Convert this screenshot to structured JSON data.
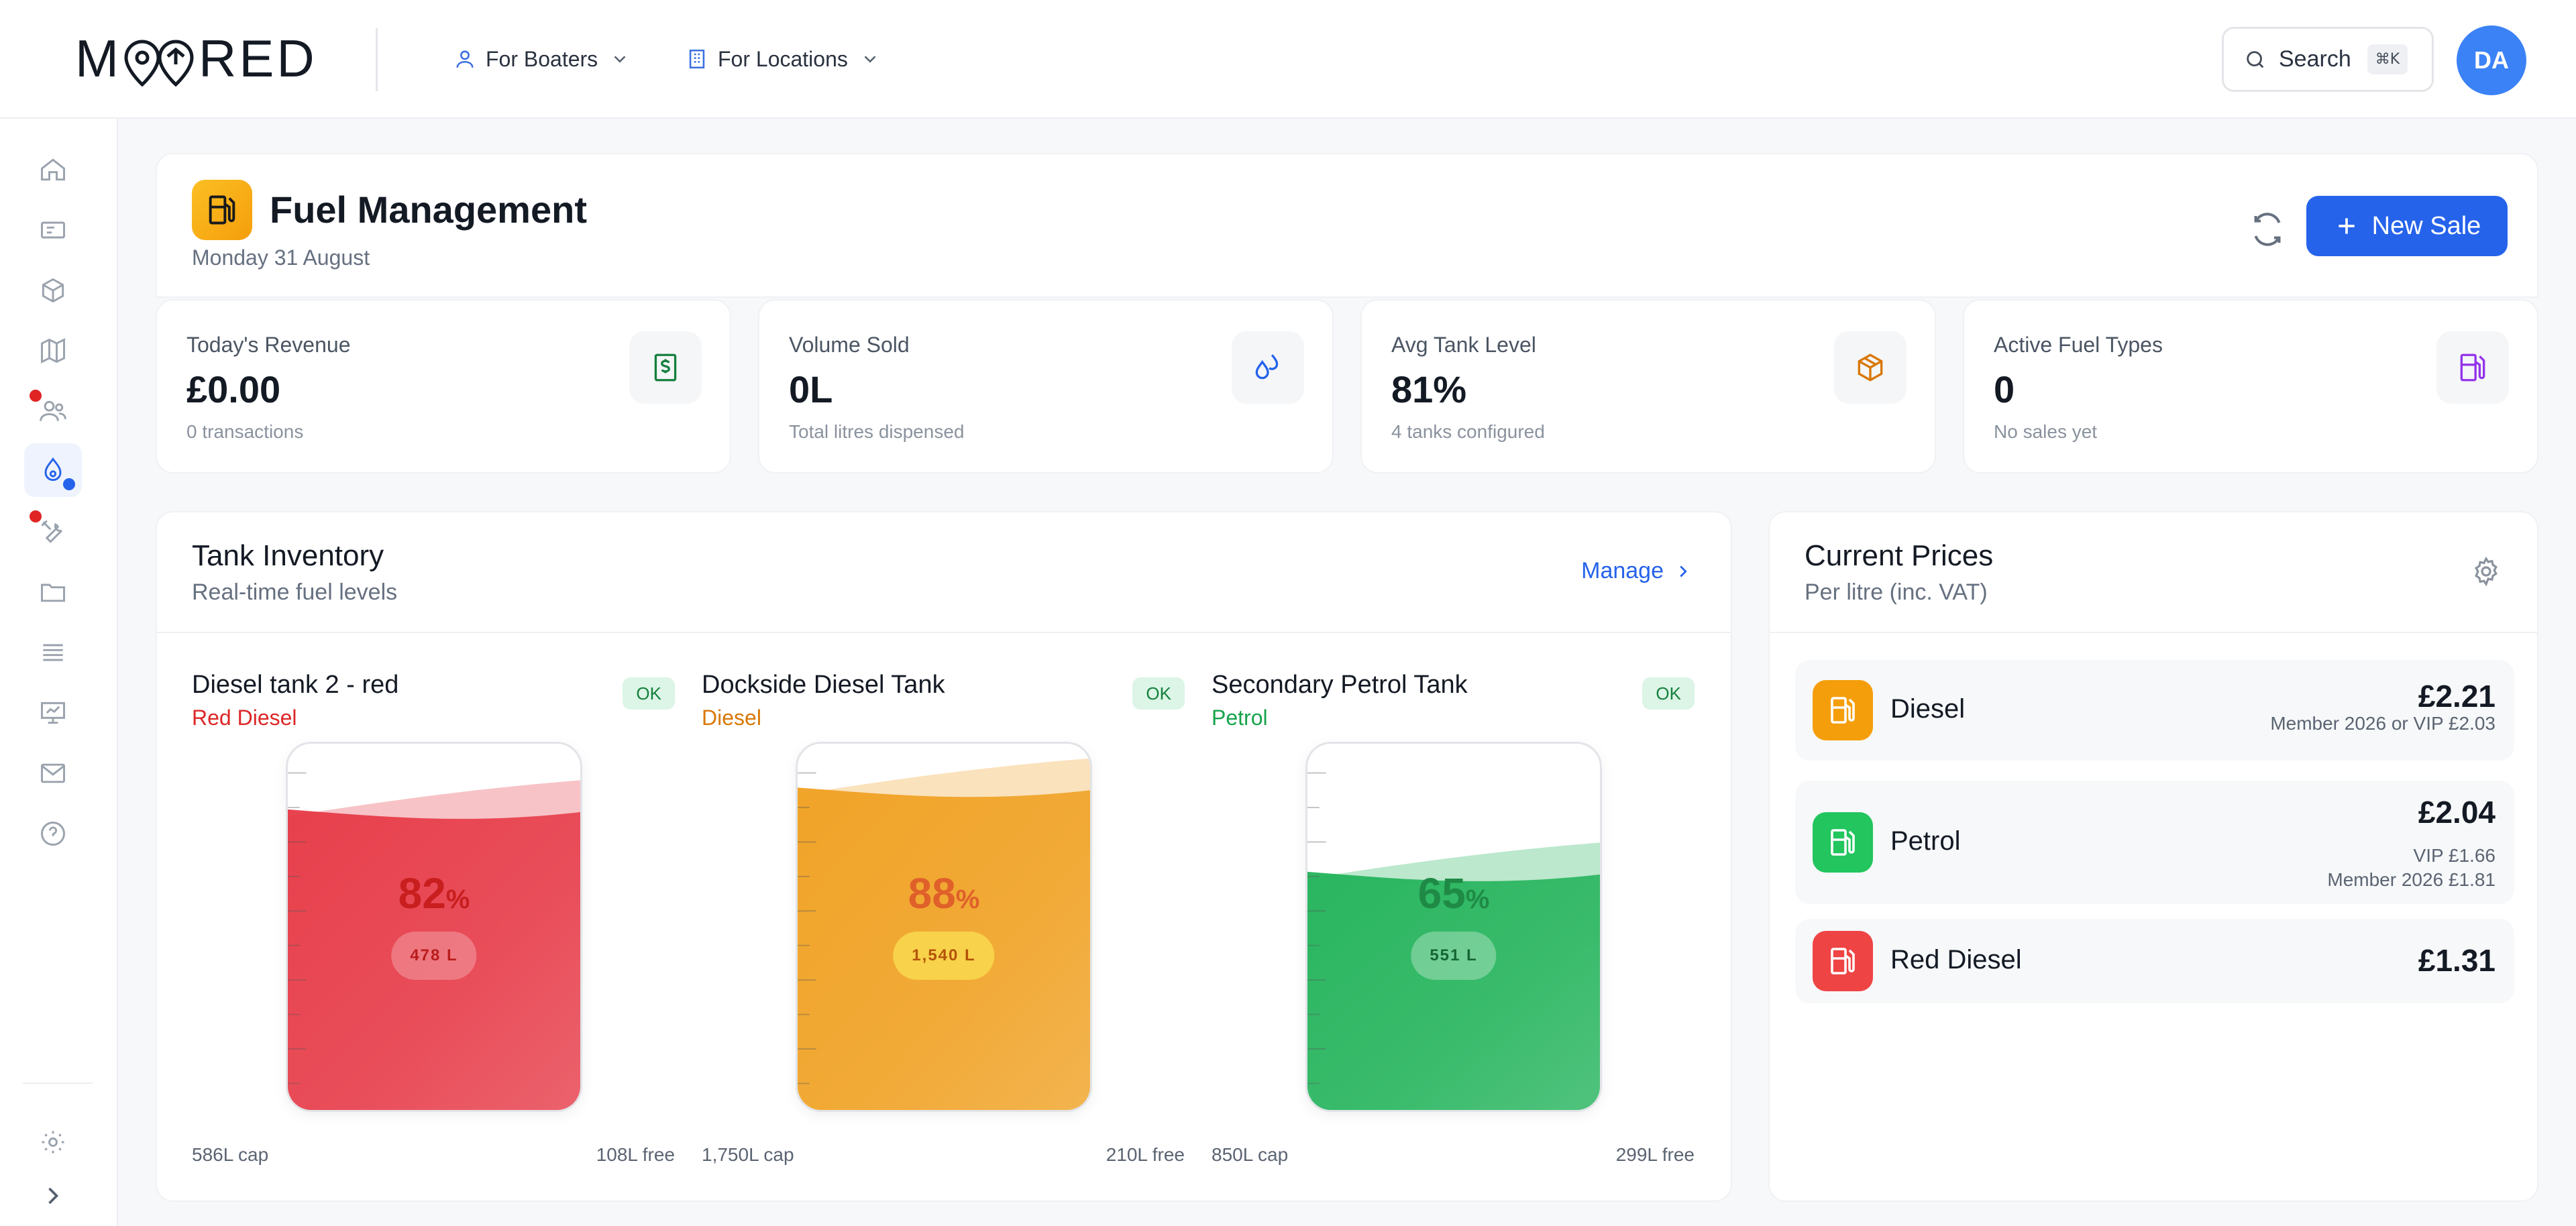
{
  "brand": {
    "logo": "MOORED"
  },
  "nav": {
    "boaters": "For Boaters",
    "locations": "For Locations"
  },
  "search": {
    "label": "Search",
    "shortcut": "⌘K"
  },
  "user": {
    "initials": "DA"
  },
  "sidebar": {
    "items": [
      {
        "icon": "home-icon"
      },
      {
        "icon": "ticket-icon"
      },
      {
        "icon": "box-icon"
      },
      {
        "icon": "map-icon"
      },
      {
        "icon": "users-icon",
        "notify": true
      },
      {
        "icon": "fuel-drop-icon",
        "active": true
      },
      {
        "icon": "tools-icon",
        "notify": true
      },
      {
        "icon": "folder-icon"
      },
      {
        "icon": "list-icon"
      },
      {
        "icon": "presentation-icon"
      },
      {
        "icon": "mail-icon"
      },
      {
        "icon": "help-icon"
      }
    ],
    "footer": [
      {
        "icon": "settings-icon"
      },
      {
        "icon": "chevron-right-icon"
      }
    ]
  },
  "header": {
    "title": "Fuel Management",
    "date": "Monday 31 August",
    "new_sale": "New Sale"
  },
  "stats": [
    {
      "label": "Today's Revenue",
      "value": "£0.00",
      "sub": "0 transactions",
      "icon": "dollar-bill-icon",
      "color": "#15803d"
    },
    {
      "label": "Volume Sold",
      "value": "0L",
      "sub": "Total litres dispensed",
      "icon": "droplets-icon",
      "color": "#2563eb"
    },
    {
      "label": "Avg Tank Level",
      "value": "81%",
      "sub": "4 tanks configured",
      "icon": "package-icon",
      "color": "#d97706"
    },
    {
      "label": "Active Fuel Types",
      "value": "0",
      "sub": "No sales yet",
      "icon": "fuel-pump-icon",
      "color": "#9333ea"
    }
  ],
  "tanks": {
    "title": "Tank Inventory",
    "subtitle": "Real-time fuel levels",
    "manage": "Manage",
    "items": [
      {
        "name": "Diesel tank 2 - red",
        "type": "Red Diesel",
        "status": "OK",
        "percent": "82",
        "litres": "478 L",
        "capacity": "586L cap",
        "free": "108L free",
        "level": 0.82,
        "color": "#e63946"
      },
      {
        "name": "Dockside Diesel Tank",
        "type": "Diesel",
        "status": "OK",
        "percent": "88",
        "litres": "1,540 L",
        "capacity": "1,750L cap",
        "free": "210L free",
        "level": 0.88,
        "color": "#f0a020"
      },
      {
        "name": "Secondary Petrol Tank",
        "type": "Petrol",
        "status": "OK",
        "percent": "65",
        "litres": "551 L",
        "capacity": "850L cap",
        "free": "299L free",
        "level": 0.65,
        "color": "#22b35a"
      }
    ]
  },
  "prices": {
    "title": "Current Prices",
    "subtitle": "Per litre (inc. VAT)",
    "items": [
      {
        "name": "Diesel",
        "price": "£2.21",
        "notes": [
          "Member 2026 or VIP £2.03"
        ],
        "color": "#f59e0b"
      },
      {
        "name": "Petrol",
        "price": "£2.04",
        "notes": [
          "VIP £1.66",
          "Member 2026 £1.81"
        ],
        "color": "#22c55e"
      },
      {
        "name": "Red Diesel",
        "price": "£1.31",
        "notes": [],
        "color": "#ef4444"
      }
    ]
  }
}
